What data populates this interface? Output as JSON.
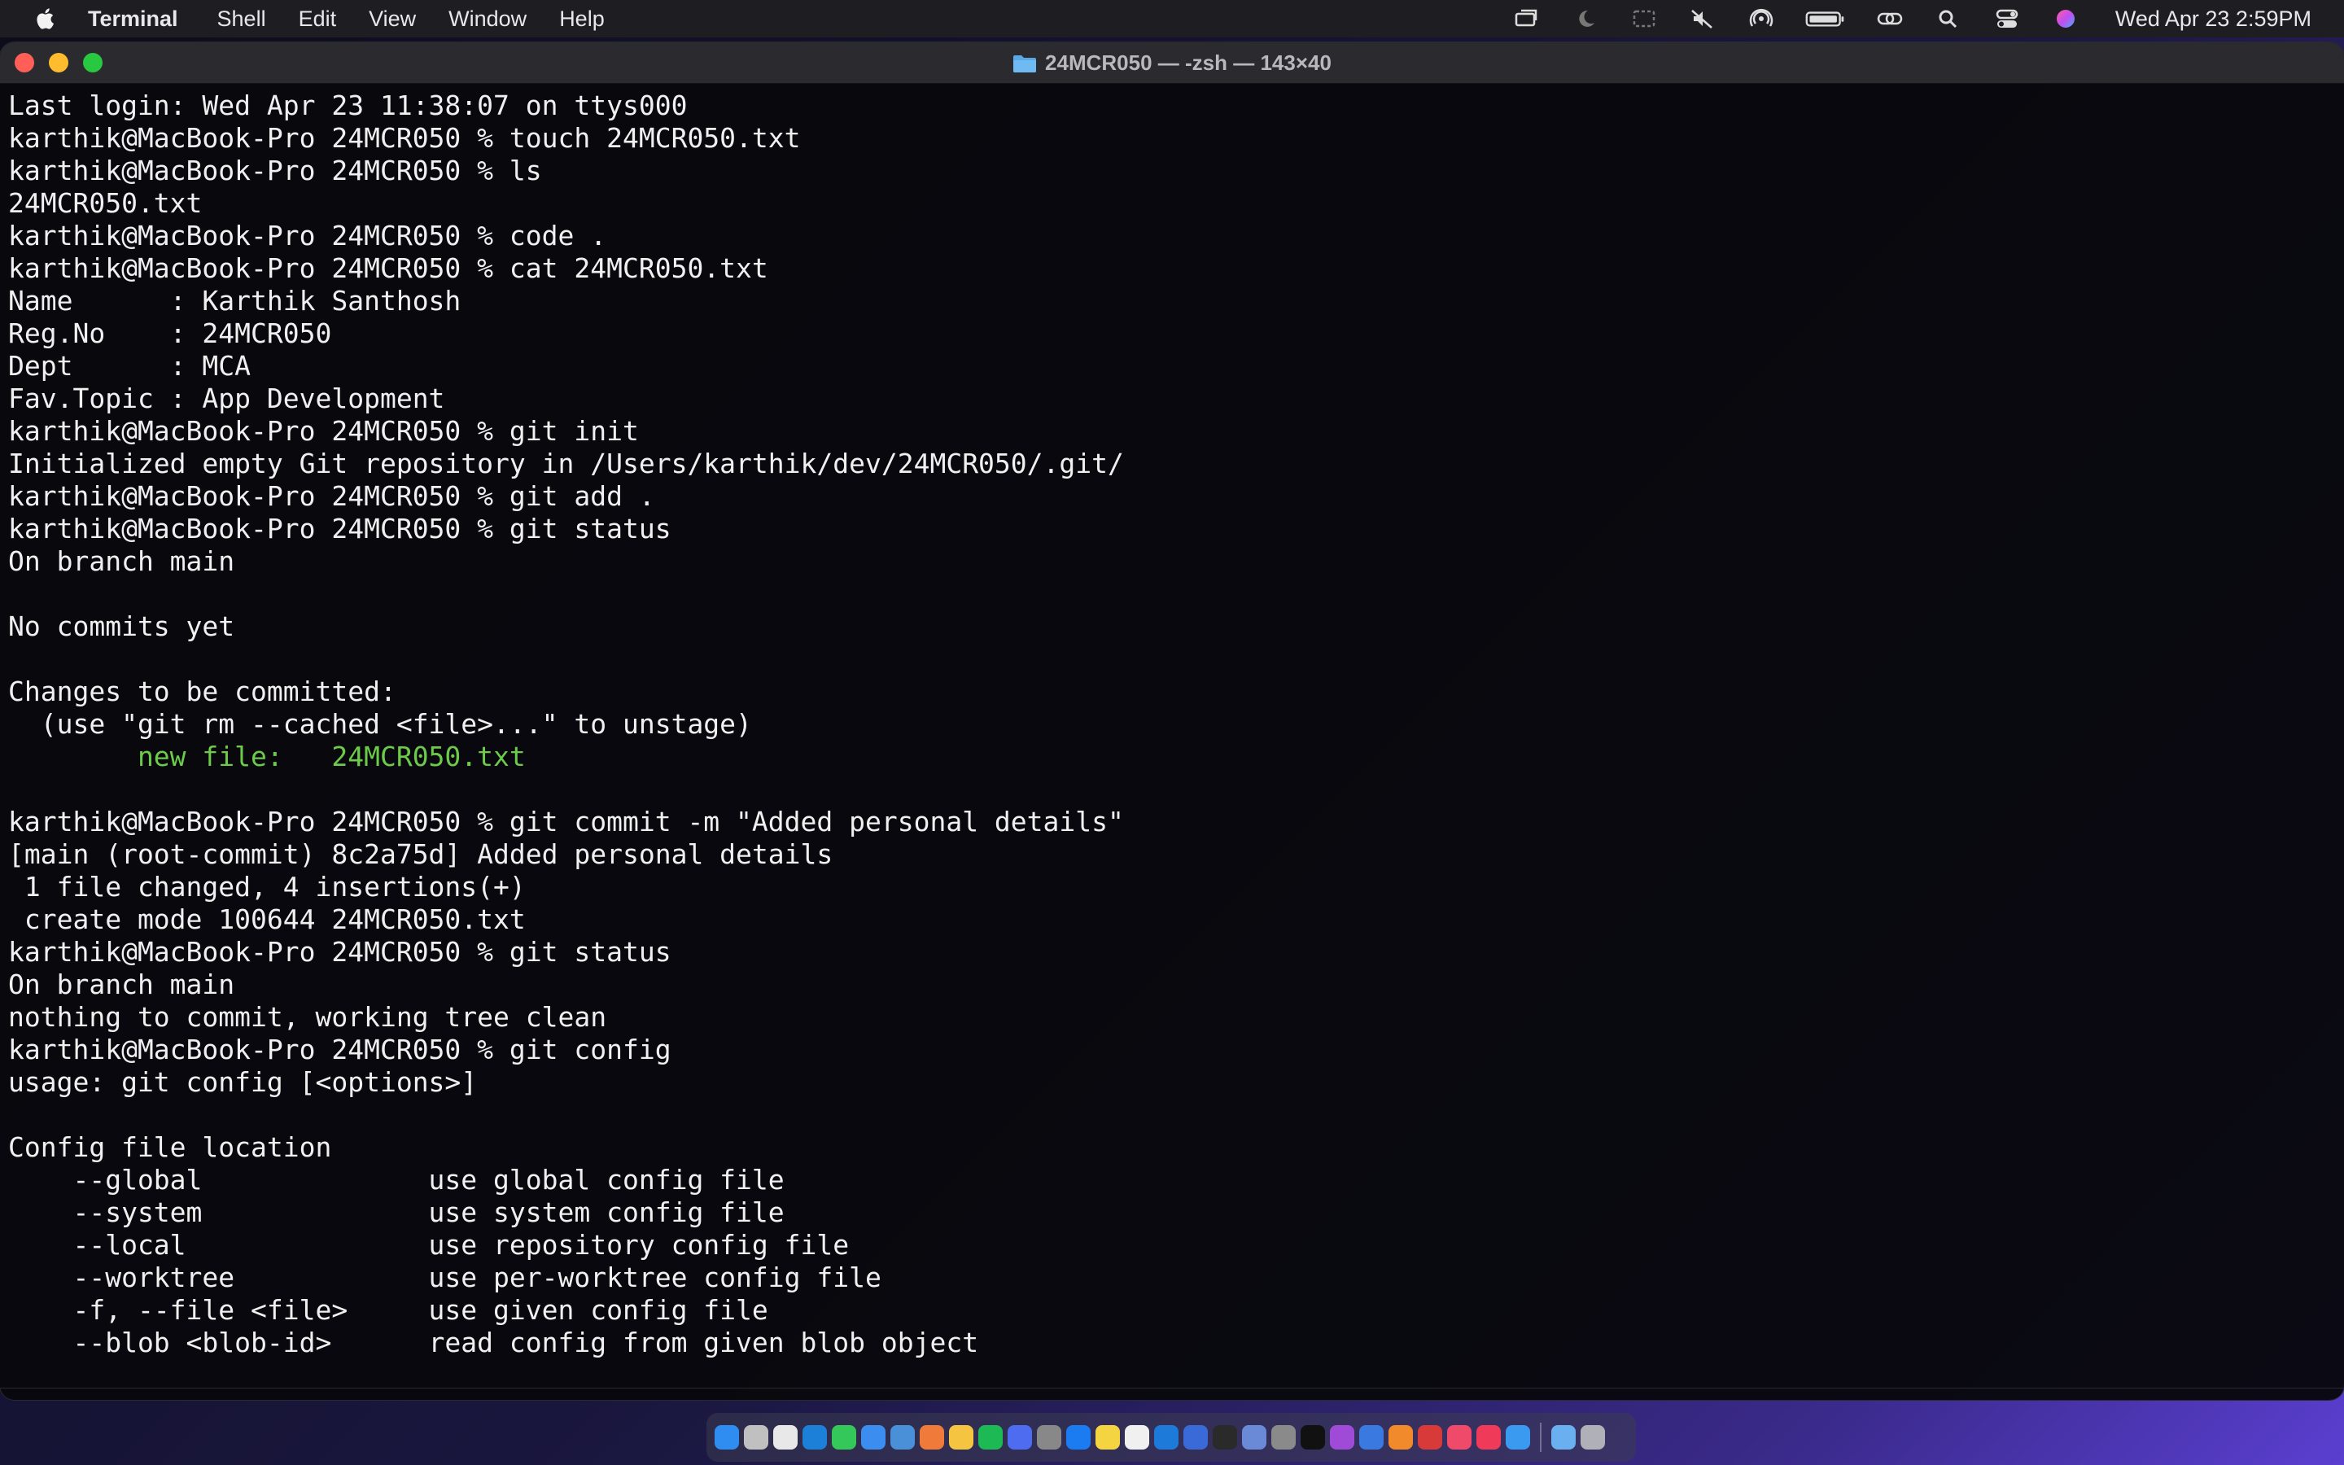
{
  "menubar": {
    "app_name": "Terminal",
    "items": [
      "Shell",
      "Edit",
      "View",
      "Window",
      "Help"
    ],
    "clock": "Wed Apr 23  2:59PM",
    "status_icons": [
      "stage-manager-icon",
      "moon-icon",
      "screen-mirror-icon",
      "mute-icon",
      "airdrop-icon",
      "battery-icon",
      "link-icon",
      "search-icon",
      "control-center-icon",
      "siri-icon"
    ]
  },
  "window": {
    "title": "24MCR050 — -zsh — 143×40"
  },
  "terminal": {
    "lines": [
      {
        "text": "Last login: Wed Apr 23 11:38:07 on ttys000"
      },
      {
        "text": "karthik@MacBook-Pro 24MCR050 % touch 24MCR050.txt"
      },
      {
        "text": "karthik@MacBook-Pro 24MCR050 % ls"
      },
      {
        "text": "24MCR050.txt"
      },
      {
        "text": "karthik@MacBook-Pro 24MCR050 % code ."
      },
      {
        "text": "karthik@MacBook-Pro 24MCR050 % cat 24MCR050.txt"
      },
      {
        "text": "Name      : Karthik Santhosh"
      },
      {
        "text": "Reg.No    : 24MCR050"
      },
      {
        "text": "Dept      : MCA"
      },
      {
        "text": "Fav.Topic : App Development"
      },
      {
        "text": "karthik@MacBook-Pro 24MCR050 % git init"
      },
      {
        "text": "Initialized empty Git repository in /Users/karthik/dev/24MCR050/.git/"
      },
      {
        "text": "karthik@MacBook-Pro 24MCR050 % git add ."
      },
      {
        "text": "karthik@MacBook-Pro 24MCR050 % git status"
      },
      {
        "text": "On branch main"
      },
      {
        "text": ""
      },
      {
        "text": "No commits yet"
      },
      {
        "text": ""
      },
      {
        "text": "Changes to be committed:"
      },
      {
        "text": "  (use \"git rm --cached <file>...\" to unstage)"
      },
      {
        "text": "\tnew file:   24MCR050.txt",
        "color": "green"
      },
      {
        "text": ""
      },
      {
        "text": "karthik@MacBook-Pro 24MCR050 % git commit -m \"Added personal details\""
      },
      {
        "text": "[main (root-commit) 8c2a75d] Added personal details"
      },
      {
        "text": " 1 file changed, 4 insertions(+)"
      },
      {
        "text": " create mode 100644 24MCR050.txt"
      },
      {
        "text": "karthik@MacBook-Pro 24MCR050 % git status"
      },
      {
        "text": "On branch main"
      },
      {
        "text": "nothing to commit, working tree clean"
      },
      {
        "text": "karthik@MacBook-Pro 24MCR050 % git config"
      },
      {
        "text": "usage: git config [<options>]"
      },
      {
        "text": ""
      },
      {
        "text": "Config file location"
      },
      {
        "text": "    --global              use global config file"
      },
      {
        "text": "    --system              use system config file"
      },
      {
        "text": "    --local               use repository config file"
      },
      {
        "text": "    --worktree            use per-worktree config file"
      },
      {
        "text": "    -f, --file <file>     use given config file"
      },
      {
        "text": "    --blob <blob-id>      read config from given blob object"
      }
    ]
  },
  "colors": {
    "green": "#6ccb48",
    "close": "#ff5f57",
    "minimize": "#febc2e",
    "maximize": "#28c840"
  },
  "dock": {
    "items": [
      "finder-icon",
      "launchpad-icon",
      "chrome-icon",
      "edge-icon",
      "messages-icon",
      "mail-icon",
      "maps-icon",
      "photos-icon",
      "notes-app-icon",
      "spotify-icon",
      "stack-icon",
      "settings-app-icon",
      "app-store-icon",
      "notes-icon",
      "reminders-icon",
      "vscode-icon",
      "xcode-icon",
      "terminal-icon",
      "preview-icon",
      "system-settings-icon",
      "chatgpt-icon",
      "podcasts-icon",
      "keynote-icon",
      "pages-icon",
      "screen-recorder-icon",
      "music-store-icon",
      "music-icon",
      "safari-icon",
      "downloads-icon",
      "trash-icon"
    ],
    "item_colors": [
      "#2f8cf0",
      "#c0c0c0",
      "#e8e8e8",
      "#1c7fd8",
      "#34c759",
      "#3b8ef0",
      "#4a90d9",
      "#f07a3a",
      "#f5c542",
      "#1db954",
      "#4d6cf0",
      "#888888",
      "#1a7cf0",
      "#f5d442",
      "#f0f0f0",
      "#1e7ad8",
      "#3a6ad8",
      "#2a2a2a",
      "#6a8ad8",
      "#8a8a8a",
      "#111111",
      "#a04ad8",
      "#3a7ae0",
      "#f08a2a",
      "#d83a3a",
      "#f04a6a",
      "#f03a5a",
      "#3a9af0",
      "#6ab0f0",
      "#b0b0b8"
    ]
  }
}
